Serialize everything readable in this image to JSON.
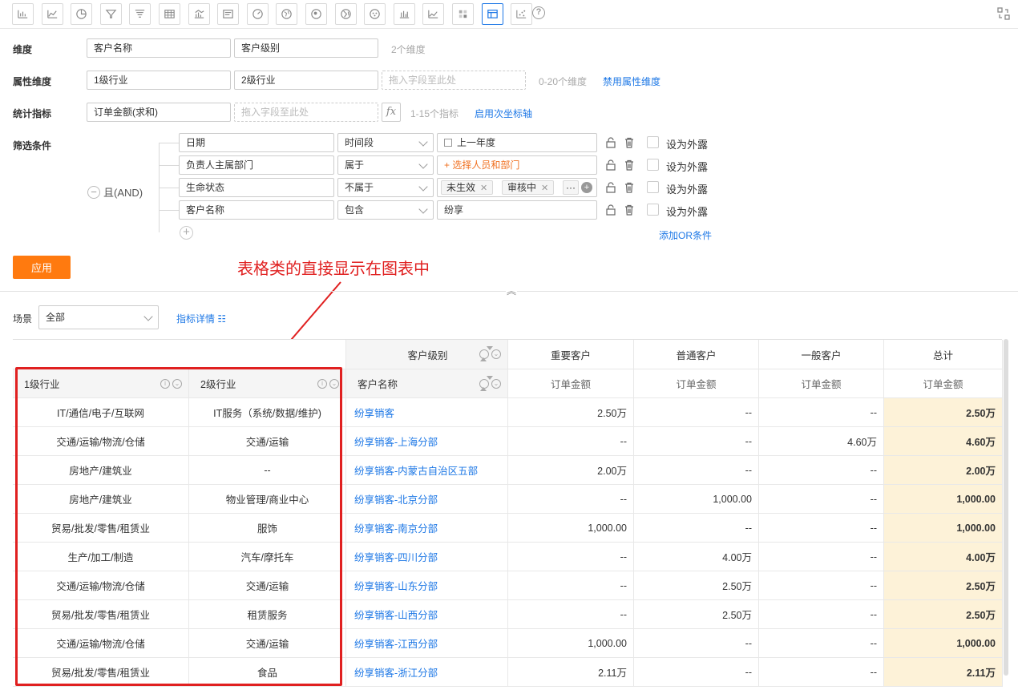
{
  "toolbar": {
    "icons": [
      "bar-chart-icon",
      "line-chart-icon",
      "pie-chart-icon",
      "funnel-icon",
      "funnel-alt-icon",
      "table-icon",
      "combo-chart-icon",
      "card-icon",
      "gauge-icon",
      "map-icon",
      "map-bubble-icon",
      "globe-icon",
      "radar-icon",
      "column-icon",
      "area-icon",
      "heatmap-icon",
      "detail-table-icon",
      "scatter-icon"
    ],
    "active_icon": "detail-table-icon",
    "help": "?"
  },
  "config": {
    "dimension": {
      "label": "维度",
      "fields": [
        "客户名称",
        "客户级别"
      ],
      "hint": "2个维度"
    },
    "attribute": {
      "label": "属性维度",
      "fields": [
        "1级行业",
        "2级行业"
      ],
      "placeholder": "拖入字段至此处",
      "hint": "0-20个维度",
      "link": "禁用属性维度"
    },
    "metric": {
      "label": "统计指标",
      "fields": [
        "订单金额(求和)"
      ],
      "placeholder": "拖入字段至此处",
      "fx": "fx",
      "hint": "1-15个指标",
      "link": "启用次坐标轴"
    },
    "filter": {
      "label": "筛选条件",
      "logic": "且(AND)",
      "rows": [
        {
          "field": "日期",
          "op": "时间段",
          "value": "上一年度",
          "external": "设为外露"
        },
        {
          "field": "负责人主属部门",
          "op": "属于",
          "value": "+ 选择人员和部门",
          "external": "设为外露"
        },
        {
          "field": "生命状态",
          "op": "不属于",
          "tags": [
            "未生效",
            "审核中"
          ],
          "more": "···",
          "external": "设为外露"
        },
        {
          "field": "客户名称",
          "op": "包含",
          "value": "纷享",
          "external": "设为外露"
        }
      ],
      "add_or": "添加OR条件"
    },
    "apply": "应用"
  },
  "annotation": "表格类的直接显示在图表中",
  "scene": {
    "label": "场景",
    "value": "全部",
    "detail_link": "指标详情 ☷"
  },
  "table": {
    "header_top": {
      "dim_label": "客户级别",
      "cols": [
        "重要客户",
        "普通客户",
        "一般客户",
        "总计"
      ]
    },
    "header_sub": {
      "l1": "1级行业",
      "l2": "2级行业",
      "name": "客户名称",
      "metric": "订单金额"
    },
    "rows": [
      {
        "l1": "IT/通信/电子/互联网",
        "l2": "IT服务（系统/数据/维护)",
        "name": "纷享销客",
        "v1": "2.50万",
        "v2": "--",
        "v3": "--",
        "total": "2.50万"
      },
      {
        "l1": "交通/运输/物流/仓储",
        "l2": "交通/运输",
        "name": "纷享销客-上海分部",
        "v1": "--",
        "v2": "--",
        "v3": "4.60万",
        "total": "4.60万"
      },
      {
        "l1": "房地产/建筑业",
        "l2": "--",
        "name": "纷享销客-内蒙古自治区五部",
        "v1": "2.00万",
        "v2": "--",
        "v3": "--",
        "total": "2.00万"
      },
      {
        "l1": "房地产/建筑业",
        "l2": "物业管理/商业中心",
        "name": "纷享销客-北京分部",
        "v1": "--",
        "v2": "1,000.00",
        "v3": "--",
        "total": "1,000.00"
      },
      {
        "l1": "贸易/批发/零售/租赁业",
        "l2": "服饰",
        "name": "纷享销客-南京分部",
        "v1": "1,000.00",
        "v2": "--",
        "v3": "--",
        "total": "1,000.00"
      },
      {
        "l1": "生产/加工/制造",
        "l2": "汽车/摩托车",
        "name": "纷享销客-四川分部",
        "v1": "--",
        "v2": "4.00万",
        "v3": "--",
        "total": "4.00万"
      },
      {
        "l1": "交通/运输/物流/仓储",
        "l2": "交通/运输",
        "name": "纷享销客-山东分部",
        "v1": "--",
        "v2": "2.50万",
        "v3": "--",
        "total": "2.50万"
      },
      {
        "l1": "贸易/批发/零售/租赁业",
        "l2": "租赁服务",
        "name": "纷享销客-山西分部",
        "v1": "--",
        "v2": "2.50万",
        "v3": "--",
        "total": "2.50万"
      },
      {
        "l1": "交通/运输/物流/仓储",
        "l2": "交通/运输",
        "name": "纷享销客-江西分部",
        "v1": "1,000.00",
        "v2": "--",
        "v3": "--",
        "total": "1,000.00"
      },
      {
        "l1": "贸易/批发/零售/租赁业",
        "l2": "食品",
        "name": "纷享销客-浙江分部",
        "v1": "2.11万",
        "v2": "--",
        "v3": "--",
        "total": "2.11万"
      }
    ]
  },
  "colors": {
    "accent": "#1e78e6",
    "apply": "#ff7a0f",
    "annotation": "#e02020",
    "total_bg": "#fdf2d8"
  }
}
